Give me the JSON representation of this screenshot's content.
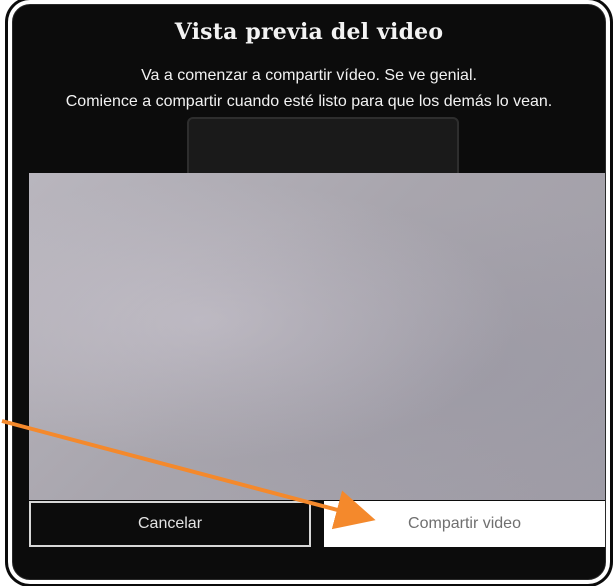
{
  "dialog": {
    "title": "Vista previa del video",
    "message_line1": "Va a comenzar a compartir vídeo. Se ve genial.",
    "message_line2": "Comience a compartir cuando esté listo para que los demás lo vean."
  },
  "buttons": {
    "cancel_label": "Cancelar",
    "share_label": "Compartir video"
  },
  "colors": {
    "dialog_background": "#0c0c0c",
    "annotation_arrow": "#f4892c"
  },
  "icons": {
    "annotation": "arrow-pointer-icon"
  }
}
